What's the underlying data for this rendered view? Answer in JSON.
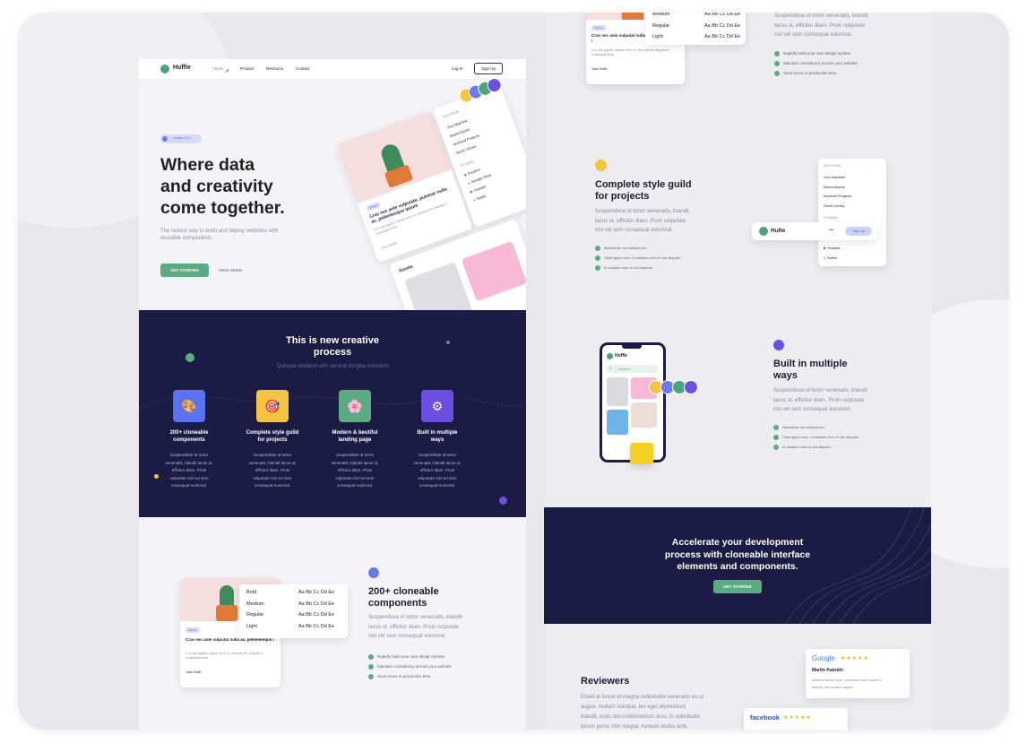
{
  "nav": {
    "brand": "Huffle",
    "items": [
      "About",
      "Product",
      "Resource",
      "Contact"
    ],
    "login": "Log In",
    "signup": "Sign Up"
  },
  "hero": {
    "badge": "version 4.0.1",
    "title_lines": [
      "Where data",
      "and creativity",
      "come together."
    ],
    "subtitle": "The fastest way to build and deploy websites with reusable components.",
    "cta_primary": "GET STARTED",
    "cta_secondary": "VIEW DEMO",
    "card": {
      "tag": "Design",
      "title": "Cras nec ante vulputate, pulvinar nulla ac, pellentesque ipsum",
      "excerpt": "In in dui sagittis, aliquet enim in, vehicula est. Aliquam a consequat tellus",
      "author": "View details"
    },
    "menu_title": "ADD FROM...",
    "menu": [
      "Your Machine",
      "Brand Assets",
      "Archived Projects",
      "Stock Library"
    ],
    "plugins_title": "PLUGINS",
    "plugins": [
      "Dropbox",
      "Google Drive",
      "Youtube",
      "Twitter"
    ],
    "assets_label": "Assets"
  },
  "process": {
    "title_lines": [
      "This is new creative",
      "process"
    ],
    "subtitle": "Quisque eleifend velit vel erat fringilla interdum",
    "features": [
      {
        "title_lines": [
          "200+ cloneable",
          "components"
        ],
        "color": "#5b73f0",
        "emoji": "🎨",
        "body": [
          "Suspendisse id tortor",
          "venenatis, blandit lacus ut,",
          "efficitur diam. Proin",
          "vulputate nisl vel sem",
          "consequat euismod."
        ]
      },
      {
        "title_lines": [
          "Complete style guild",
          "for projects"
        ],
        "color": "#f5c440",
        "emoji": "🎯",
        "body": [
          "Suspendisse id tortor",
          "venenatis, blandit lacus ut,",
          "efficitur diam. Proin",
          "vulputate nisl vel sem",
          "consequat euismod."
        ]
      },
      {
        "title_lines": [
          "Modern & beutiful",
          "landing page"
        ],
        "color": "#5aab82",
        "emoji": "🌸",
        "body": [
          "Suspendisse id tortor",
          "venenatis, blandit lacus ut,",
          "efficitur diam. Proin",
          "vulputate nisl vel sem",
          "consequat euismod."
        ]
      },
      {
        "title_lines": [
          "Built in multiple",
          "ways"
        ],
        "color": "#6a4fe0",
        "emoji": "⚙",
        "body": [
          "Suspendisse id tortor",
          "venenatis, blandit lacus ut,",
          "efficitur diam. Proin",
          "vulputate nisl vel sem",
          "consequat euismod."
        ]
      }
    ]
  },
  "components_section": {
    "title_lines": [
      "200+ cloneable",
      "components"
    ],
    "body_lines": [
      "Suspendisse id tortor venenatis, blandit",
      "lacus ut, efficitur diam. Proin vulputate",
      "nisl vel sem consequat euismod."
    ],
    "bullets": [
      "Rapidly build your own design system",
      "Maintain consistency across your website",
      "Save hours in production time"
    ],
    "type_rows": [
      {
        "weight": "Bold",
        "sample": "Aa Bb Cc Dd Ee"
      },
      {
        "weight": "Medium",
        "sample": "Aa Bb Cc Dd Ee"
      },
      {
        "weight": "Regular",
        "sample": "Aa Bb Cc Dd Ee"
      },
      {
        "weight": "Light",
        "sample": "Aa Bb Cc Dd Ee"
      }
    ],
    "card": {
      "tag": "Design",
      "title": "Cras nec ante vulputat nulla ac, pellentesque i",
      "excerpt": "In in dui sagittis, aliquet enim in, vehicula est. Aliquam a consequat tellus",
      "author": "Jane Smith"
    }
  },
  "right_top": {
    "type_rows": [
      {
        "weight": "Medium",
        "sample": "Aa Bb Cc Dd Ee"
      },
      {
        "weight": "Regular",
        "sample": "Aa Bb Cc Dd Ee"
      },
      {
        "weight": "Light",
        "sample": "Aa Bb Cc Dd Ee"
      }
    ],
    "card": {
      "tag": "Design",
      "title": "Cras nec ante vulputat nulla ac, pellentesque i",
      "excerpt": "In in dui sagittis, aliquet enim in, vehicula est. Aliquam a consequat tellus",
      "author": "Jane Smith"
    },
    "body_lines": [
      "Suspendisse id tortor venenatis, blandit",
      "lacus ut, efficitur diam. Proin vulputate",
      "nisl vel sem consequat euismod."
    ],
    "bullets": [
      "Rapidly build your own design system",
      "Maintain consistency across your website",
      "Save hours in production time"
    ]
  },
  "style_section": {
    "title_lines": [
      "Complete style guild",
      "for projects"
    ],
    "body_lines": [
      "Suspendisse id tortor venenatis, blandit",
      "lacus ut, efficitur diam. Proin vulputate",
      "nisl vel sem consequat euismod."
    ],
    "bullets": [
      "Maecenas vel volutpat orci",
      "Vitae ligula nunc. In sodales nunc in dui aliquam",
      "In sodales nunc in dui aliquam"
    ],
    "menu_title": "ADD FROM...",
    "menu": [
      "Your Machine",
      "Brand Assets",
      "Archived Projects",
      "Stock Library"
    ],
    "plugins_title": "PLUGINS",
    "plugins": [
      "Youtube",
      "Twitter"
    ],
    "bar_brand": "Hufle",
    "bar_more": "•••",
    "bar_signup": "Sign up"
  },
  "multi_section": {
    "title_lines": [
      "Built in multiple",
      "ways"
    ],
    "body_lines": [
      "Suspendisse id tortor venenatis, blandit",
      "lacus ut, efficitur diam. Proin vulputate",
      "nisl vel sem consequat euismod."
    ],
    "bullets": [
      "Maecenas vel volutpat orci",
      "Vitae ligula nunc. In sodales nunc in dui aliquam",
      "In sodales nunc in dui aliquam"
    ],
    "phone_brand": "Huffle",
    "phone_search": "Search"
  },
  "cta_banner": {
    "title_lines": [
      "Accelerate your development",
      "process with cloneable interface",
      "elements and components."
    ],
    "button": "GET STARTED"
  },
  "reviewers": {
    "title": "Reviewers",
    "body_lines": [
      "Etiam at lorem et magna sollicitudin venenatis eu ut",
      "augue. Nullam volutpat, leo eget elementum",
      "blandit, nunc nisl condimentum arcu, in sollicitudin",
      "ipsum purus non magna. Aenean lectus ante,"
    ],
    "google": {
      "brand": "Google",
      "stars": "★★★★★",
      "name": "Martin Katoshi",
      "text_lines": [
        "Aenean lectus ante, venenatis sed mauris a,",
        "facilisis accumsan magna."
      ]
    },
    "facebook": {
      "brand": "facebook",
      "stars": "★★★★★"
    }
  },
  "colors": {
    "accent": "#5aab82",
    "dark": "#1c1b44",
    "purple": "#6a4fe0",
    "yellow": "#f5c440",
    "blue": "#5b73f0"
  }
}
